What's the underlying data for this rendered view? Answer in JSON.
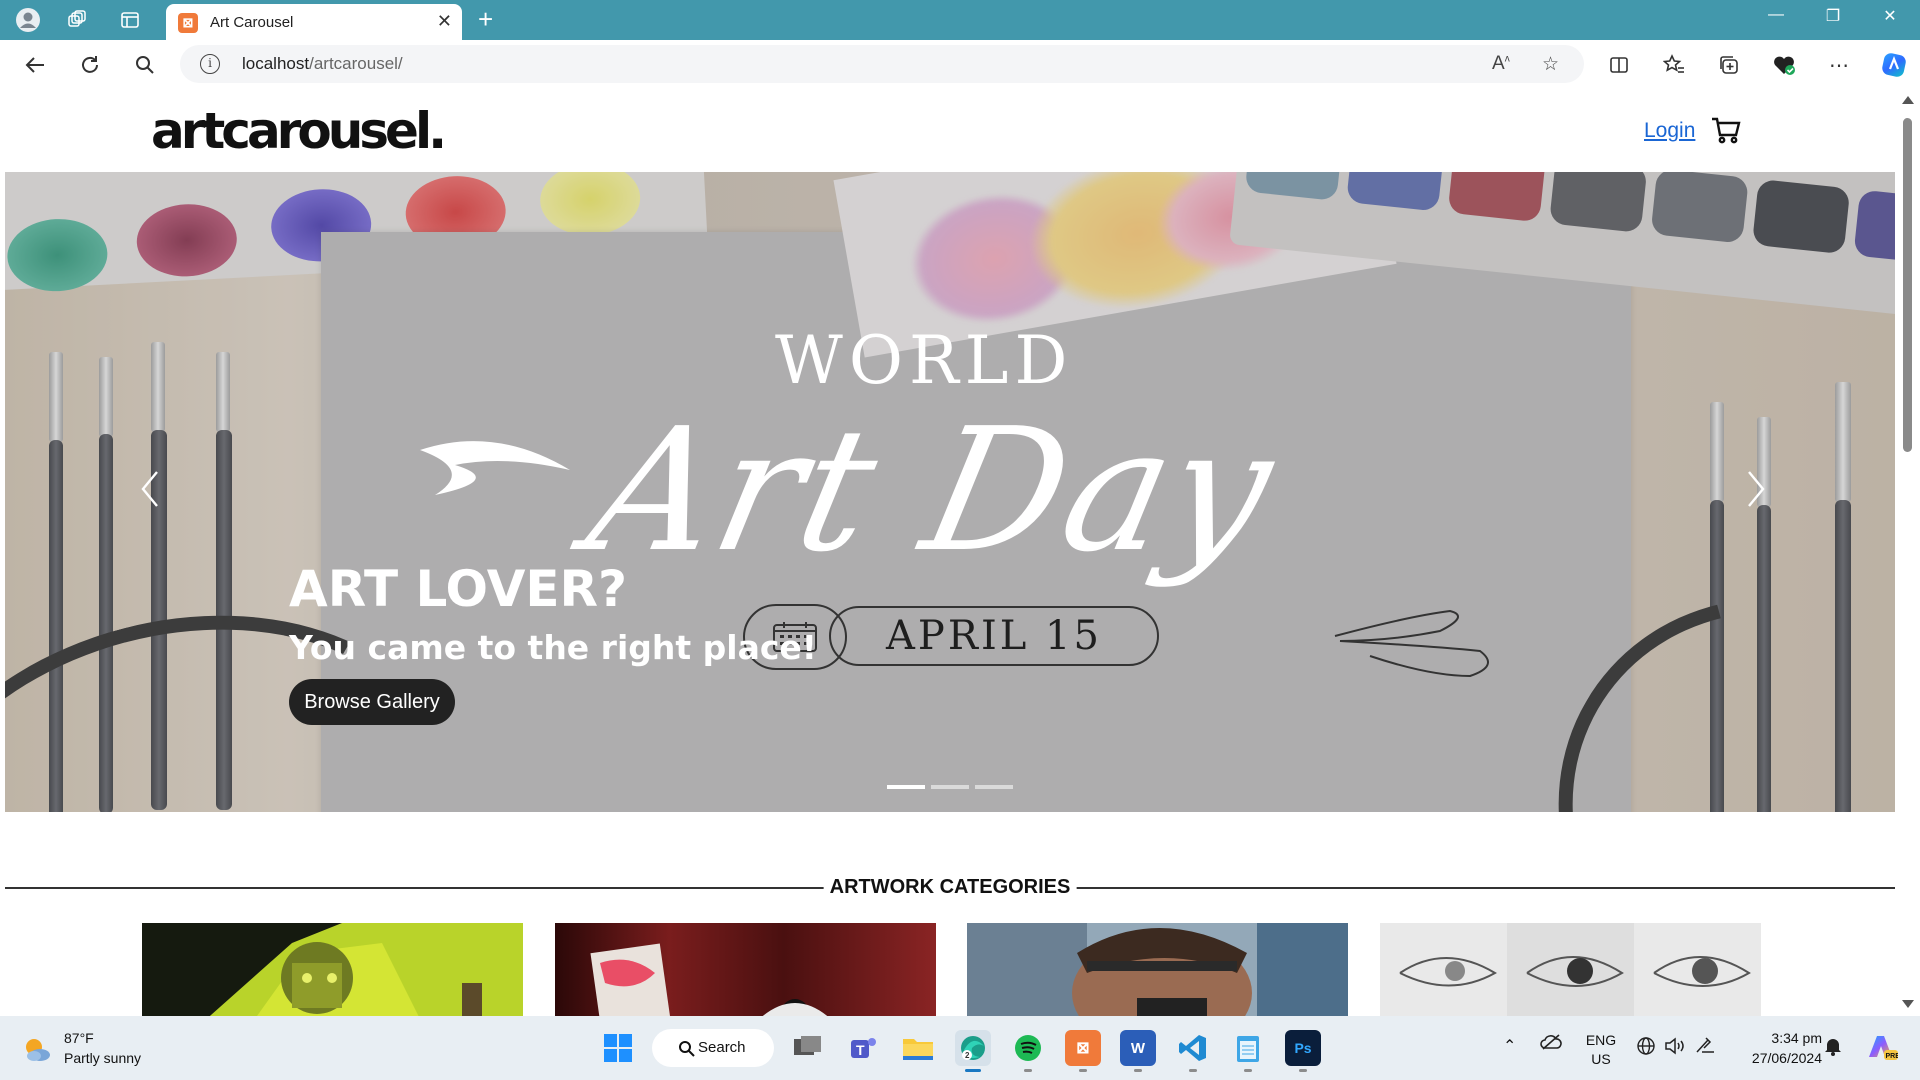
{
  "browser": {
    "tab_title": "Art Carousel",
    "tab_favicon": "xampp-icon",
    "url_host": "localhost",
    "url_path": "/artcarousel/"
  },
  "site": {
    "logo": "artcarousel.",
    "login_label": "Login",
    "cart_icon": "cart-icon"
  },
  "carousel": {
    "slide_world": "WORLD",
    "slide_artday": "Art Day",
    "slide_date": "APRIL 15",
    "caption_title": "ART LOVER?",
    "caption_subtitle": "You came to the right place!",
    "button_label": "Browse Gallery",
    "indicator_count": 3,
    "active_indicator": 0
  },
  "categories": {
    "title": "ARTWORK CATEGORIES",
    "cards": [
      "card-1",
      "card-2",
      "card-3",
      "card-4"
    ]
  },
  "taskbar": {
    "weather_temp": "87°F",
    "weather_desc": "Partly sunny",
    "search_label": "Search",
    "lang_top": "ENG",
    "lang_bottom": "US",
    "time": "3:34 pm",
    "date": "27/06/2024"
  },
  "colors": {
    "titlebar": "#4298ac",
    "link": "#1a66d4",
    "button": "#222222"
  }
}
